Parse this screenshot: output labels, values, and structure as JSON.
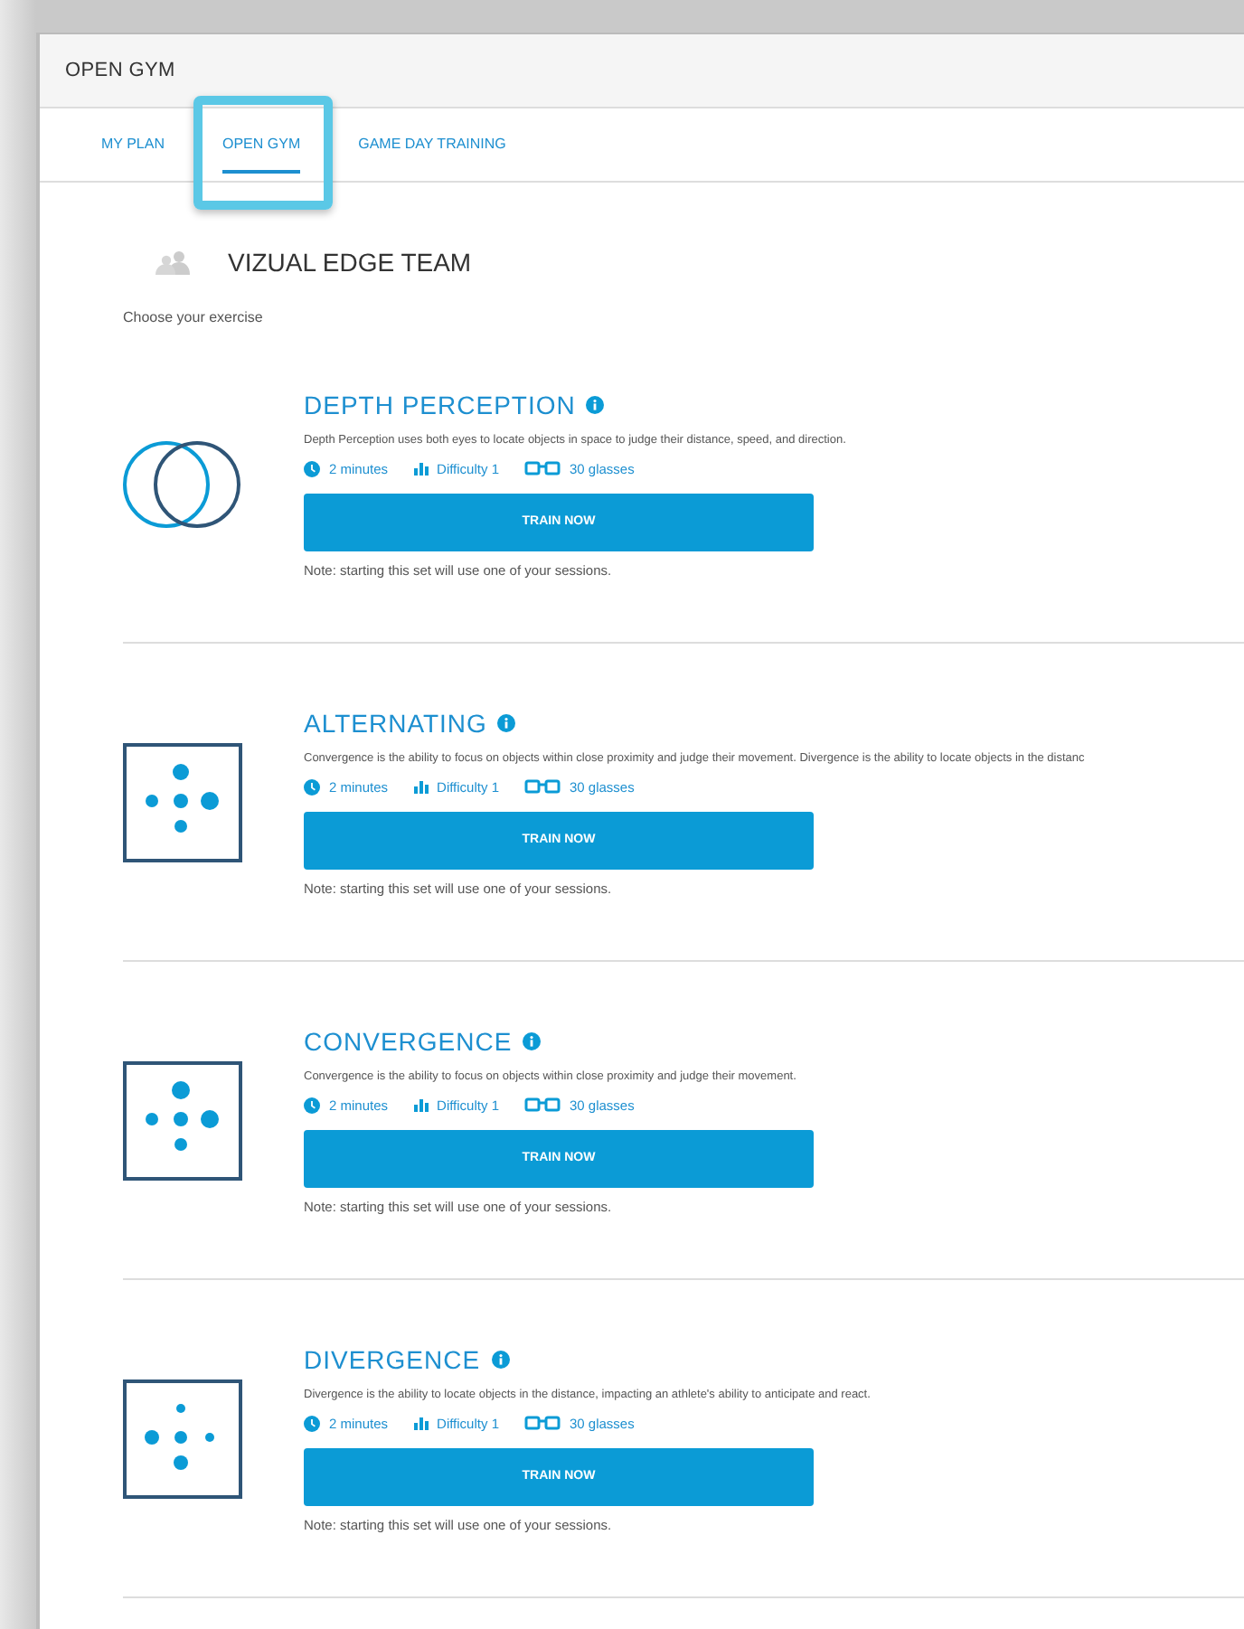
{
  "window": {
    "title": "OPEN GYM"
  },
  "tabs": [
    {
      "label": "MY PLAN",
      "selected": false,
      "highlighted": false
    },
    {
      "label": "OPEN GYM",
      "selected": true,
      "highlighted": true
    },
    {
      "label": "GAME DAY TRAINING",
      "selected": false,
      "highlighted": false
    }
  ],
  "team": {
    "name": "VIZUAL EDGE TEAM"
  },
  "prompt": "Choose your exercise",
  "exercises": [
    {
      "kind": "circles",
      "title": "DEPTH PERCEPTION",
      "description": "Depth Perception uses both eyes to locate objects in space to judge their distance, speed, and direction.",
      "duration": "2 minutes",
      "difficulty": "Difficulty 1",
      "glasses": "30 glasses",
      "button": "TRAIN NOW",
      "note": "Note: starting this set will use one of your sessions."
    },
    {
      "kind": "dots-alternating",
      "title": "ALTERNATING",
      "description": "Convergence is the ability to focus on objects within close proximity and judge their movement. Divergence is the ability to locate objects in the distanc",
      "duration": "2 minutes",
      "difficulty": "Difficulty 1",
      "glasses": "30 glasses",
      "button": "TRAIN NOW",
      "note": "Note: starting this set will use one of your sessions."
    },
    {
      "kind": "dots-convergence",
      "title": "CONVERGENCE",
      "description": "Convergence is the ability to focus on objects within close proximity and judge their movement.",
      "duration": "2 minutes",
      "difficulty": "Difficulty 1",
      "glasses": "30 glasses",
      "button": "TRAIN NOW",
      "note": "Note: starting this set will use one of your sessions."
    },
    {
      "kind": "dots-divergence",
      "title": "DIVERGENCE",
      "description": "Divergence is the ability to locate objects in the distance, impacting an athlete's ability to anticipate and react.",
      "duration": "2 minutes",
      "difficulty": "Difficulty 1",
      "glasses": "30 glasses",
      "button": "TRAIN NOW",
      "note": "Note: starting this set will use one of your sessions."
    }
  ]
}
